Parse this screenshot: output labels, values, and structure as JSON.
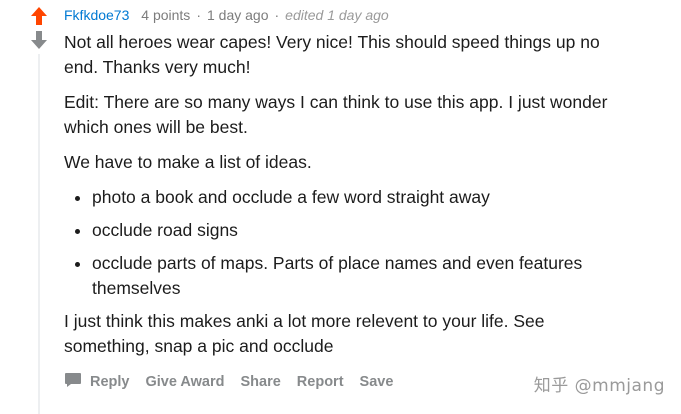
{
  "comment": {
    "author": "Fkfkdoe73",
    "points": "4 points",
    "separator": "·",
    "time": "1 day ago",
    "edited": "edited 1 day ago",
    "paragraphs": {
      "p1": "Not all heroes wear capes! Very nice! This should speed things up no end. Thanks very much!",
      "p2": "Edit: There are so many ways I can think to use this app. I just wonder which ones will be best.",
      "p3": "We have to make a list of ideas.",
      "p4": "I just think this makes anki a lot more relevent to your life. See something, snap a pic and occlude"
    },
    "ideas": [
      "photo a book and occlude a few word straight away",
      "occlude road signs",
      "occlude parts of maps. Parts of place names and even features themselves"
    ]
  },
  "vote": {
    "upvote_icon": "arrow-up-icon",
    "downvote_icon": "arrow-down-icon",
    "upvote_color": "#ff4500",
    "downvote_color": "#878a8c"
  },
  "actions": {
    "reply": "Reply",
    "give_award": "Give Award",
    "share": "Share",
    "report": "Report",
    "save": "Save",
    "reply_icon": "comment-bubble-icon"
  },
  "watermark": "知乎 @mmjang",
  "colors": {
    "author": "#0079d3",
    "meta": "#7c7c7c",
    "body_text": "#1c1c1c",
    "action_text": "#878a8c"
  }
}
